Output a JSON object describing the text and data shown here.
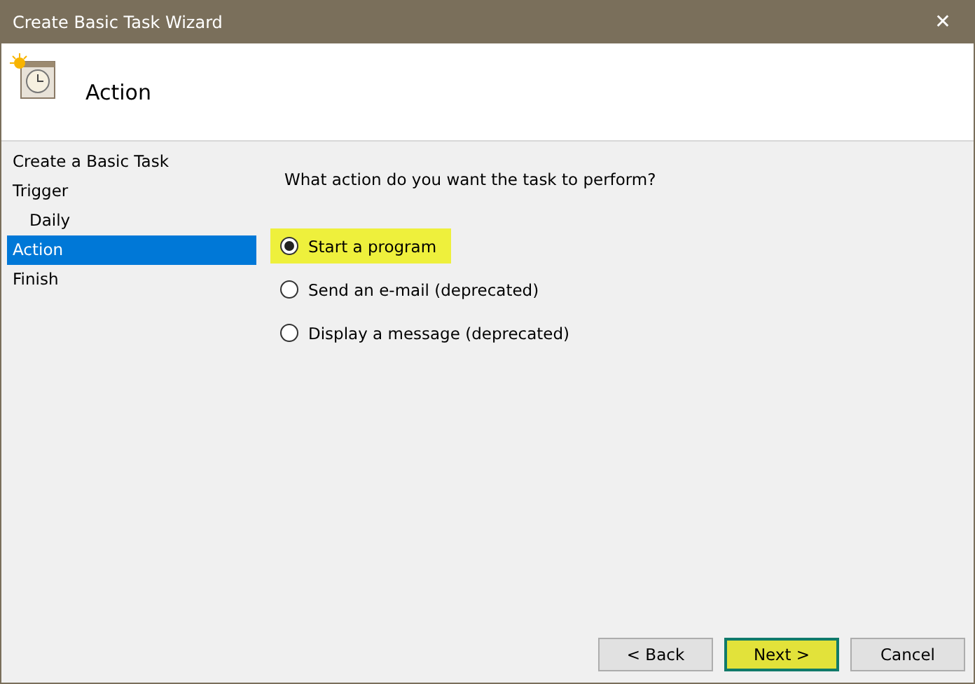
{
  "window": {
    "title": "Create Basic Task Wizard",
    "close": "✕"
  },
  "header": {
    "title": "Action"
  },
  "sidebar": {
    "items": [
      {
        "label": "Create a Basic Task",
        "selected": false
      },
      {
        "label": "Trigger",
        "selected": false,
        "children": [
          {
            "label": "Daily",
            "selected": false
          }
        ]
      },
      {
        "label": "Action",
        "selected": true
      },
      {
        "label": "Finish",
        "selected": false
      }
    ]
  },
  "content": {
    "question": "What action do you want the task to perform?",
    "options": [
      {
        "label": "Start a program",
        "selected": true,
        "highlighted": true
      },
      {
        "label": "Send an e-mail (deprecated)",
        "selected": false,
        "highlighted": false
      },
      {
        "label": "Display a message (deprecated)",
        "selected": false,
        "highlighted": false
      }
    ]
  },
  "buttons": [
    {
      "label": "< Back",
      "highlighted": false
    },
    {
      "label": "Next >",
      "highlighted": true
    },
    {
      "label": "Cancel",
      "highlighted": false
    }
  ]
}
